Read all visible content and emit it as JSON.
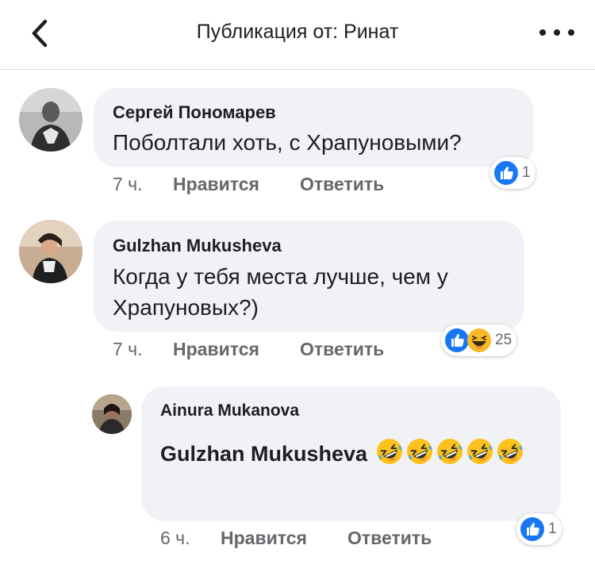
{
  "header": {
    "title": "Публикация от: Ринат"
  },
  "comments": [
    {
      "author": "Сергей Пономарев",
      "text": "Поболтали хоть, с Храпуновыми?",
      "time": "7 ч.",
      "like_label": "Нравится",
      "reply_label": "Ответить",
      "reactions": [
        "like"
      ],
      "reaction_count": "1"
    },
    {
      "author": "Gulzhan Mukusheva",
      "text_line1": "Когда у тебя места лучше, чем у",
      "text_line2": "Храпуновых?)",
      "time": "7 ч.",
      "like_label": "Нравится",
      "reply_label": "Ответить",
      "reactions": [
        "like",
        "haha"
      ],
      "reaction_count": "25"
    }
  ],
  "reply": {
    "author": "Ainura Mukanova",
    "mention": "Gulzhan Mukusheva",
    "emoji": "rolling-on-floor-laughing",
    "emoji_count": 5,
    "time": "6 ч.",
    "like_label": "Нравится",
    "reply_label": "Ответить",
    "reactions": [
      "like"
    ],
    "reaction_count": "1"
  },
  "colors": {
    "like_blue": "#1877f2",
    "bubble_bg": "#f0f2f5",
    "meta_gray": "#65676b",
    "haha_yellow": "#f7b928"
  }
}
